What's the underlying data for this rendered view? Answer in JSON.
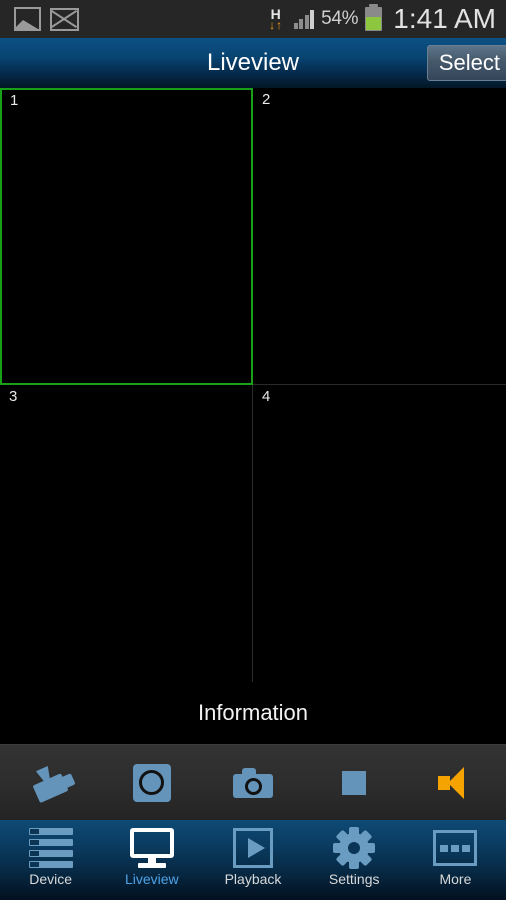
{
  "status_bar": {
    "icons_left": [
      "gallery-icon",
      "mail-icon"
    ],
    "network_type": "H",
    "network_arrows": "↓↑",
    "battery_percent": "54%",
    "time": "1:41 AM"
  },
  "title_bar": {
    "title": "Liveview",
    "select_label": "Select"
  },
  "grid": {
    "cells": [
      {
        "label": "1",
        "selected": true
      },
      {
        "label": "2",
        "selected": false
      },
      {
        "label": "3",
        "selected": false
      },
      {
        "label": "4",
        "selected": false
      }
    ],
    "selection_color": "#18a018"
  },
  "info_bar": {
    "text": "Information"
  },
  "toolbar": {
    "items": [
      {
        "name": "ptz-control-icon",
        "active": false
      },
      {
        "name": "record-icon",
        "active": false
      },
      {
        "name": "snapshot-icon",
        "active": false
      },
      {
        "name": "stop-icon",
        "active": false
      },
      {
        "name": "audio-speaker-icon",
        "active": true
      }
    ],
    "accent_color": "#6494ba",
    "active_color": "#f5a300"
  },
  "bottom_nav": {
    "items": [
      {
        "label": "Device",
        "icon": "device-list-icon",
        "active": false
      },
      {
        "label": "Liveview",
        "icon": "monitor-icon",
        "active": true
      },
      {
        "label": "Playback",
        "icon": "play-icon",
        "active": false
      },
      {
        "label": "Settings",
        "icon": "gear-icon",
        "active": false
      },
      {
        "label": "More",
        "icon": "more-icon",
        "active": false
      }
    ],
    "active_color": "#4ea3e8",
    "icon_color": "#6a9cc2"
  }
}
